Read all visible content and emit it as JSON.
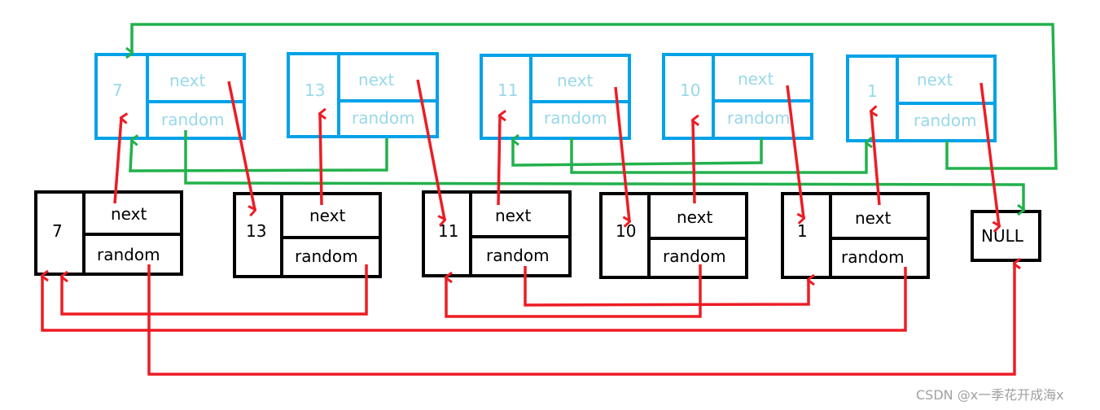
{
  "copy_list": {
    "nodes": [
      {
        "val": "7",
        "next": "next",
        "random": "random"
      },
      {
        "val": "13",
        "next": "next",
        "random": "random"
      },
      {
        "val": "11",
        "next": "next",
        "random": "random"
      },
      {
        "val": "10",
        "next": "next",
        "random": "random"
      },
      {
        "val": "1",
        "next": "next",
        "random": "random"
      }
    ],
    "color": "#00a2e8",
    "text_color": "#99d9ea",
    "random_link_color": "#22b14c"
  },
  "original_list": {
    "nodes": [
      {
        "val": "7",
        "next": "next",
        "random": "random"
      },
      {
        "val": "13",
        "next": "next",
        "random": "random"
      },
      {
        "val": "11",
        "next": "next",
        "random": "random"
      },
      {
        "val": "10",
        "next": "next",
        "random": "random"
      },
      {
        "val": "1",
        "next": "next",
        "random": "random"
      }
    ],
    "null_label": "NULL",
    "color": "#000000",
    "link_color": "#ed1c24"
  },
  "watermark": "CSDN @x一季花开成海x"
}
